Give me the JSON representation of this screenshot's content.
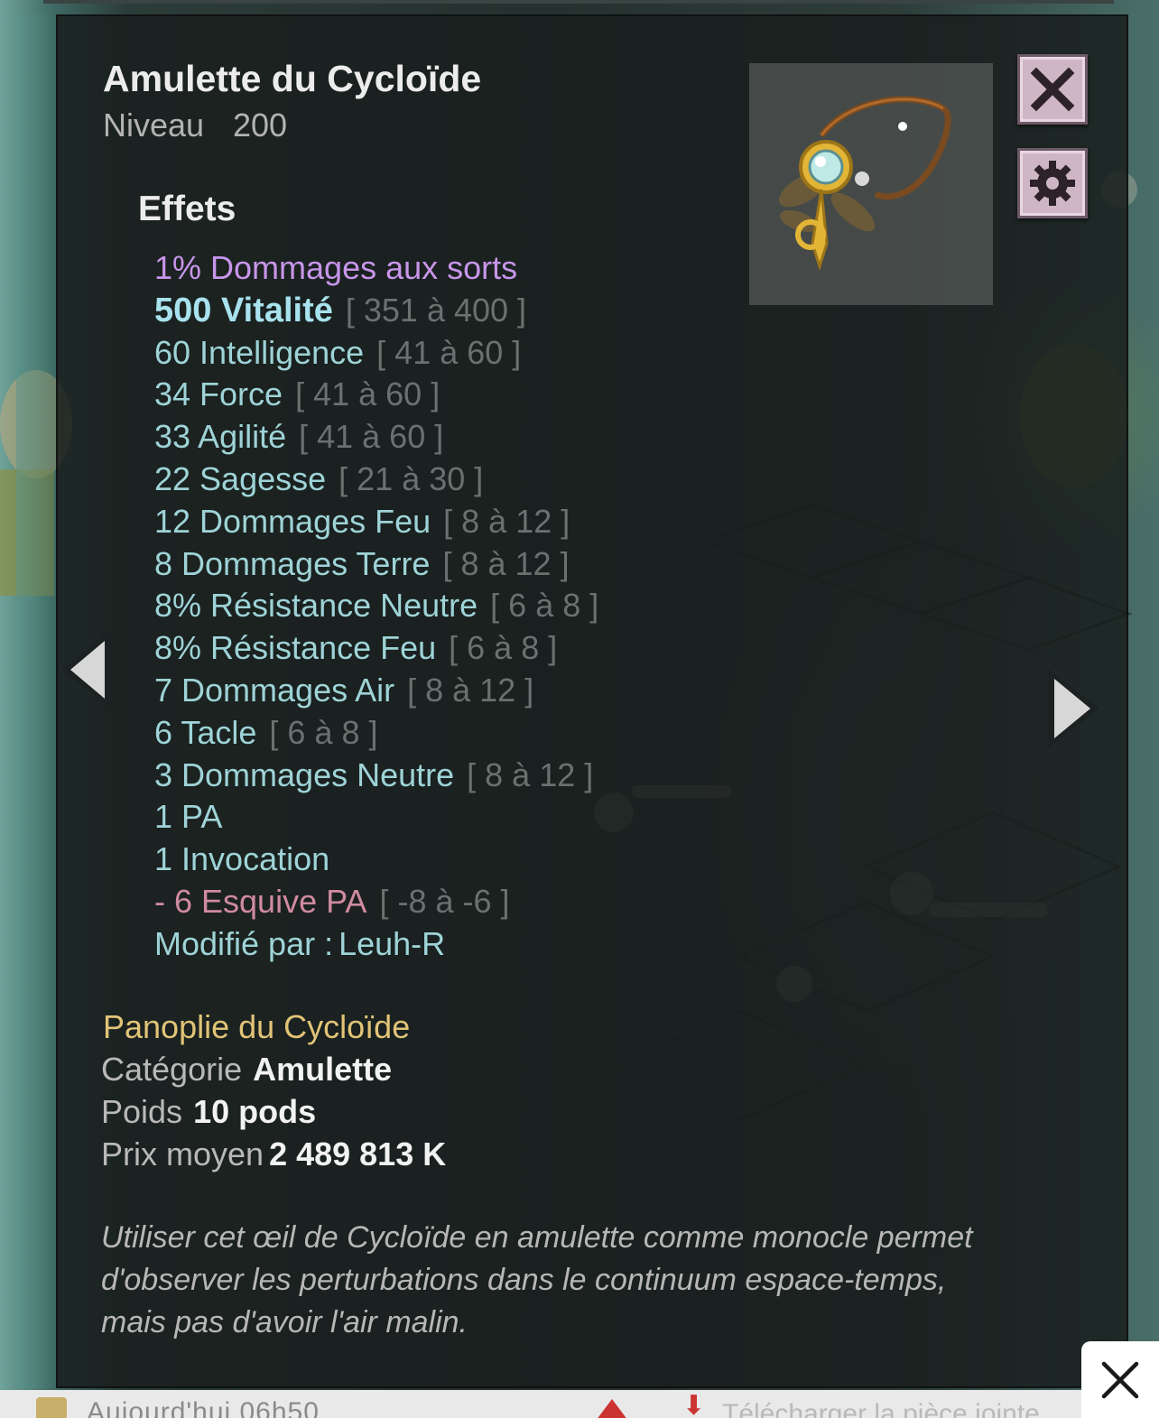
{
  "colors": {
    "panel_bg": "#181e1d",
    "effect_default": "#9ed3d7",
    "effect_purple": "#c895ea",
    "effect_negative": "#d08aa2",
    "range_grey": "#6a7170",
    "set_gold": "#e2c477",
    "button_pink": "#cfb6c5"
  },
  "item": {
    "title": "Amulette du Cycloïde",
    "level_label": "Niveau",
    "level_value": "200",
    "image_icon": "amulet-monocle-icon"
  },
  "buttons": {
    "close_icon": "close-icon",
    "settings_icon": "gear-icon"
  },
  "effects": {
    "title": "Effets",
    "rows": [
      {
        "text": "1% Dommages aux sorts",
        "range": "",
        "style": "purple"
      },
      {
        "text": "500 Vitalité",
        "range": "[ 351 à 400 ]",
        "style": "bright"
      },
      {
        "text": "60 Intelligence",
        "range": "[ 41 à 60 ]",
        "style": "default"
      },
      {
        "text": "34 Force",
        "range": "[ 41 à 60 ]",
        "style": "default"
      },
      {
        "text": "33 Agilité",
        "range": "[ 41 à 60 ]",
        "style": "default"
      },
      {
        "text": "22 Sagesse",
        "range": "[ 21 à 30 ]",
        "style": "default"
      },
      {
        "text": "12 Dommages Feu",
        "range": "[ 8 à 12 ]",
        "style": "default"
      },
      {
        "text": "8 Dommages Terre",
        "range": "[ 8 à 12 ]",
        "style": "default"
      },
      {
        "text": "8% Résistance Neutre",
        "range": "[ 6 à 8 ]",
        "style": "default"
      },
      {
        "text": "8% Résistance Feu",
        "range": "[ 6 à 8 ]",
        "style": "default"
      },
      {
        "text": "7 Dommages Air",
        "range": "[ 8 à 12 ]",
        "style": "default"
      },
      {
        "text": "6 Tacle",
        "range": "[ 6 à 8 ]",
        "style": "default"
      },
      {
        "text": "3 Dommages Neutre",
        "range": "[ 8 à 12 ]",
        "style": "default"
      },
      {
        "text": "1 PA",
        "range": "",
        "style": "default"
      },
      {
        "text": "1 Invocation",
        "range": "",
        "style": "default"
      },
      {
        "text": "- 6 Esquive PA",
        "range": "[ -8 à -6 ]",
        "style": "red"
      }
    ],
    "modified_by_label": "Modifié par :",
    "modified_by_value": "Leuh-R"
  },
  "details": {
    "set_name": "Panoplie du Cycloïde",
    "category_label": "Catégorie",
    "category_value": "Amulette",
    "weight_label": "Poids",
    "weight_value": "10 pods",
    "price_label": "Prix moyen",
    "price_value": "2 489 813 K"
  },
  "description": "Utiliser cet œil de Cycloïde en amulette comme monocle permet d'observer les perturbations dans le continuum espace-temps, mais pas d'avoir l'air malin.",
  "navigation": {
    "prev_icon": "triangle-left-icon",
    "next_icon": "triangle-right-icon"
  },
  "overlay": {
    "close_icon": "close-icon"
  },
  "background_hint": {
    "bottom_text": "Aujourd'hui  06h50",
    "bottom_text_right": "Télécharger la pièce jointe"
  }
}
